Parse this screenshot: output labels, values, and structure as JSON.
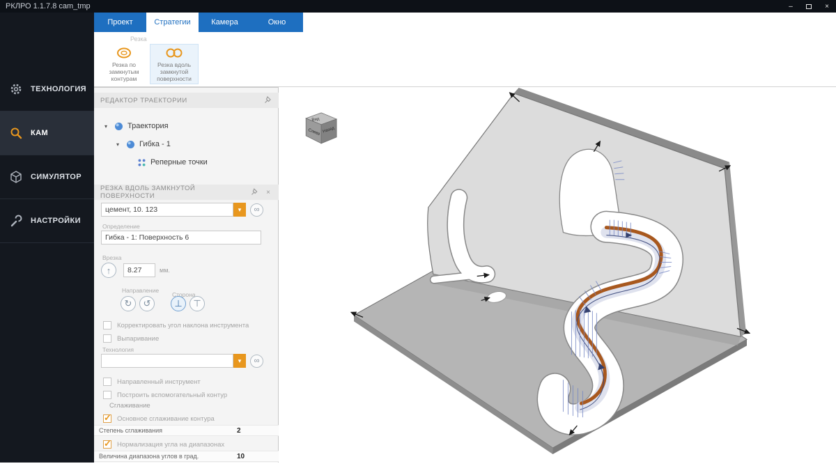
{
  "window": {
    "title": "РКЛРО 1.1.7.8 cam_tmp"
  },
  "colors": {
    "accent_orange": "#e8971e",
    "tab_blue": "#1e6fc0",
    "sidebar_bg": "#14181f",
    "cut_surface_orange": "#a8581e",
    "hatch_blue": "#7486c4"
  },
  "sidebar": {
    "items": [
      {
        "label": "ТЕХНОЛОГИЯ",
        "icon": "gear-icon"
      },
      {
        "label": "КАМ",
        "icon": "magnifier-icon"
      },
      {
        "label": "СИМУЛЯТОР",
        "icon": "cube-icon"
      },
      {
        "label": "НАСТРОЙКИ",
        "icon": "wrench-icon"
      }
    ]
  },
  "tabs": [
    {
      "label": "Проект"
    },
    {
      "label": "Стратегии"
    },
    {
      "label": "Камера"
    },
    {
      "label": "Окно"
    }
  ],
  "ribbon": {
    "group_label": "Резка",
    "button1_label": "Резка по замкнутым контурам",
    "button2_label": "Резка вдоль замкнутой поверхности"
  },
  "trajectory_panel": {
    "title": "РЕДАКТОР ТРАЕКТОРИИ",
    "node1": "Траектория",
    "node2": "Гибка - 1",
    "node3": "Реперные точки"
  },
  "strategy_panel": {
    "title": "РЕЗКА ВДОЛЬ ЗАМКНУТОЙ ПОВЕРХНОСТИ",
    "material_value": "цемент, 10. 123",
    "definition_label": "Определение",
    "definition_value": "Гибка - 1: Поверхность 6",
    "plunge_label": "Врезка",
    "plunge_value": "8.27",
    "plunge_unit": "мм.",
    "direction_label": "Направление",
    "side_label": "Сторона",
    "chk_correct_angle": "Корректировать угол наклона инструмента",
    "chk_evaporation": "Выпаривание",
    "technology_label": "Технология",
    "technology_value": "",
    "chk_directed_tool": "Направленный инструмент",
    "chk_aux_contour": "Построить вспомогательный контур",
    "smoothing_section": "Сглаживание",
    "chk_main_smoothing": "Основное сглаживание контура",
    "smoothing_degree_label": "Степень сглаживания",
    "smoothing_degree_value": "2",
    "chk_angle_normalization": "Нормализация угла на диапазонах",
    "angle_range_label": "Величина диапазона углов в град.",
    "angle_range_value": "10"
  },
  "viewport": {
    "nav_cube": {
      "top": "Вид",
      "front": "Слева",
      "side": "Назад"
    }
  }
}
